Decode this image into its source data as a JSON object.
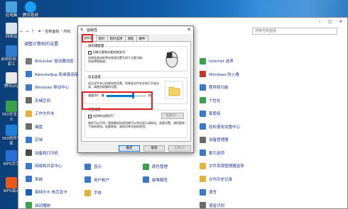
{
  "desktop": {
    "icons": [
      {
        "label": "此电脑",
        "color": "#4aa3df"
      },
      {
        "label": "回收站",
        "color": "#d9e6f2"
      },
      {
        "label": "启用轻松\n大家江",
        "color": "#2f7dd1"
      },
      {
        "label": "腾讯QQ",
        "color": "#e9e9e9"
      },
      {
        "label": "360安全卫士",
        "color": "#3aa04a"
      },
      {
        "label": "360软件管家",
        "color": "#1e7fd6"
      },
      {
        "label": "WPS文字",
        "color": "#2b6fd6"
      },
      {
        "label": "WPS演示",
        "color": "#e8591a"
      }
    ],
    "second_col_icon": {
      "label": "腾讯视频",
      "color": "#1ca0f2"
    }
  },
  "control_panel": {
    "address_crumbs": [
      "控制面板",
      "所有"
    ],
    "search_placeholder": "搜索控制面板",
    "heading": "调整计算机的设置",
    "left_items": [
      {
        "label": "BitLocker 驱动器加密",
        "color": "#7a7a7a"
      },
      {
        "label": "RemoteApp 和桌面连接",
        "color": "#3a78c8"
      },
      {
        "label": "Windows 移动中心",
        "color": "#3a78c8"
      },
      {
        "label": "存储空间",
        "color": "#6a6a6a"
      },
      {
        "label": "工作文件夹",
        "color": "#e3b23c"
      },
      {
        "label": "键盘",
        "color": "#6a6a6a"
      },
      {
        "label": "区域",
        "color": "#3a78c8"
      },
      {
        "label": "设备和打印机",
        "color": "#4a4a4a"
      },
      {
        "label": "网络和共享中心",
        "color": "#3a78c8"
      },
      {
        "label": "系统",
        "color": "#3a78c8"
      },
      {
        "label": "英特尔® 核芯显卡",
        "color": "#1a5fb4"
      },
      {
        "label": "自动播放",
        "color": "#3aa04a"
      }
    ],
    "mid_items": [
      {
        "label": "显示",
        "color": "#3a78c8"
      },
      {
        "label": "用户帐户",
        "color": "#3a78c8"
      },
      {
        "label": "字体",
        "color": "#e3b23c"
      }
    ],
    "mid2_items": [
      {
        "label": "颜色管理",
        "color": "#3aa04a"
      },
      {
        "label": "疑难解答",
        "color": "#3a78c8"
      }
    ],
    "right_items": [
      {
        "label": "Internet 选项",
        "color": "#3aa04a"
      },
      {
        "label": "Windows 防火墙",
        "color": "#c0392b"
      },
      {
        "label": "程序和功能",
        "color": "#3a78c8"
      },
      {
        "label": "个性化",
        "color": "#3aa04a"
      },
      {
        "label": "家庭组",
        "color": "#3a78c8"
      },
      {
        "label": "轻松使用设置中心",
        "color": "#3a78c8"
      },
      {
        "label": "设备管理器",
        "color": "#6a6a6a"
      },
      {
        "label": "索引选项",
        "color": "#3a78c8"
      },
      {
        "label": "文件资源管理器选项",
        "color": "#e3b23c"
      },
      {
        "label": "文件历史记录",
        "color": "#e3b23c"
      },
      {
        "label": "语言",
        "color": "#3a78c8"
      },
      {
        "label": "语音识别",
        "color": "#6a6a6a"
      }
    ]
  },
  "mouse_dialog": {
    "title": "属性",
    "title_prefix": "鼠",
    "tabs": [
      "鼠标键",
      "指针",
      "指针选项",
      "滑轮",
      "硬件"
    ],
    "active_tab": 0,
    "group1_label": "鼠标键配置",
    "group1_checkbox": "切换主要和次要的按钮(S)",
    "group1_desc": "选择此复选框将右按钮设置为用于主要功能，如选择和拖放。",
    "group2_label": "双击速度",
    "group2_desc": "双击文件夹以检查你的设置。如果该文件夹没有打开或关闭，请使用较慢的设置。",
    "speed_label": "速度(D):",
    "speed_slow": "慢",
    "speed_fast": "快",
    "speed_value": 0.68,
    "group3_label": "单击锁定",
    "group3_checkbox": "启用单击锁定(T)",
    "group3_settings_btn": "设置(E)...",
    "group3_desc": "使你可以不用一直按着鼠标按钮就可以突出显示或拖动。若要设置，请短暂按下鼠标按钮。若要释放，请再次单击鼠标按钮。",
    "ok": "确定",
    "cancel": "取消",
    "apply": "应用(A)"
  }
}
